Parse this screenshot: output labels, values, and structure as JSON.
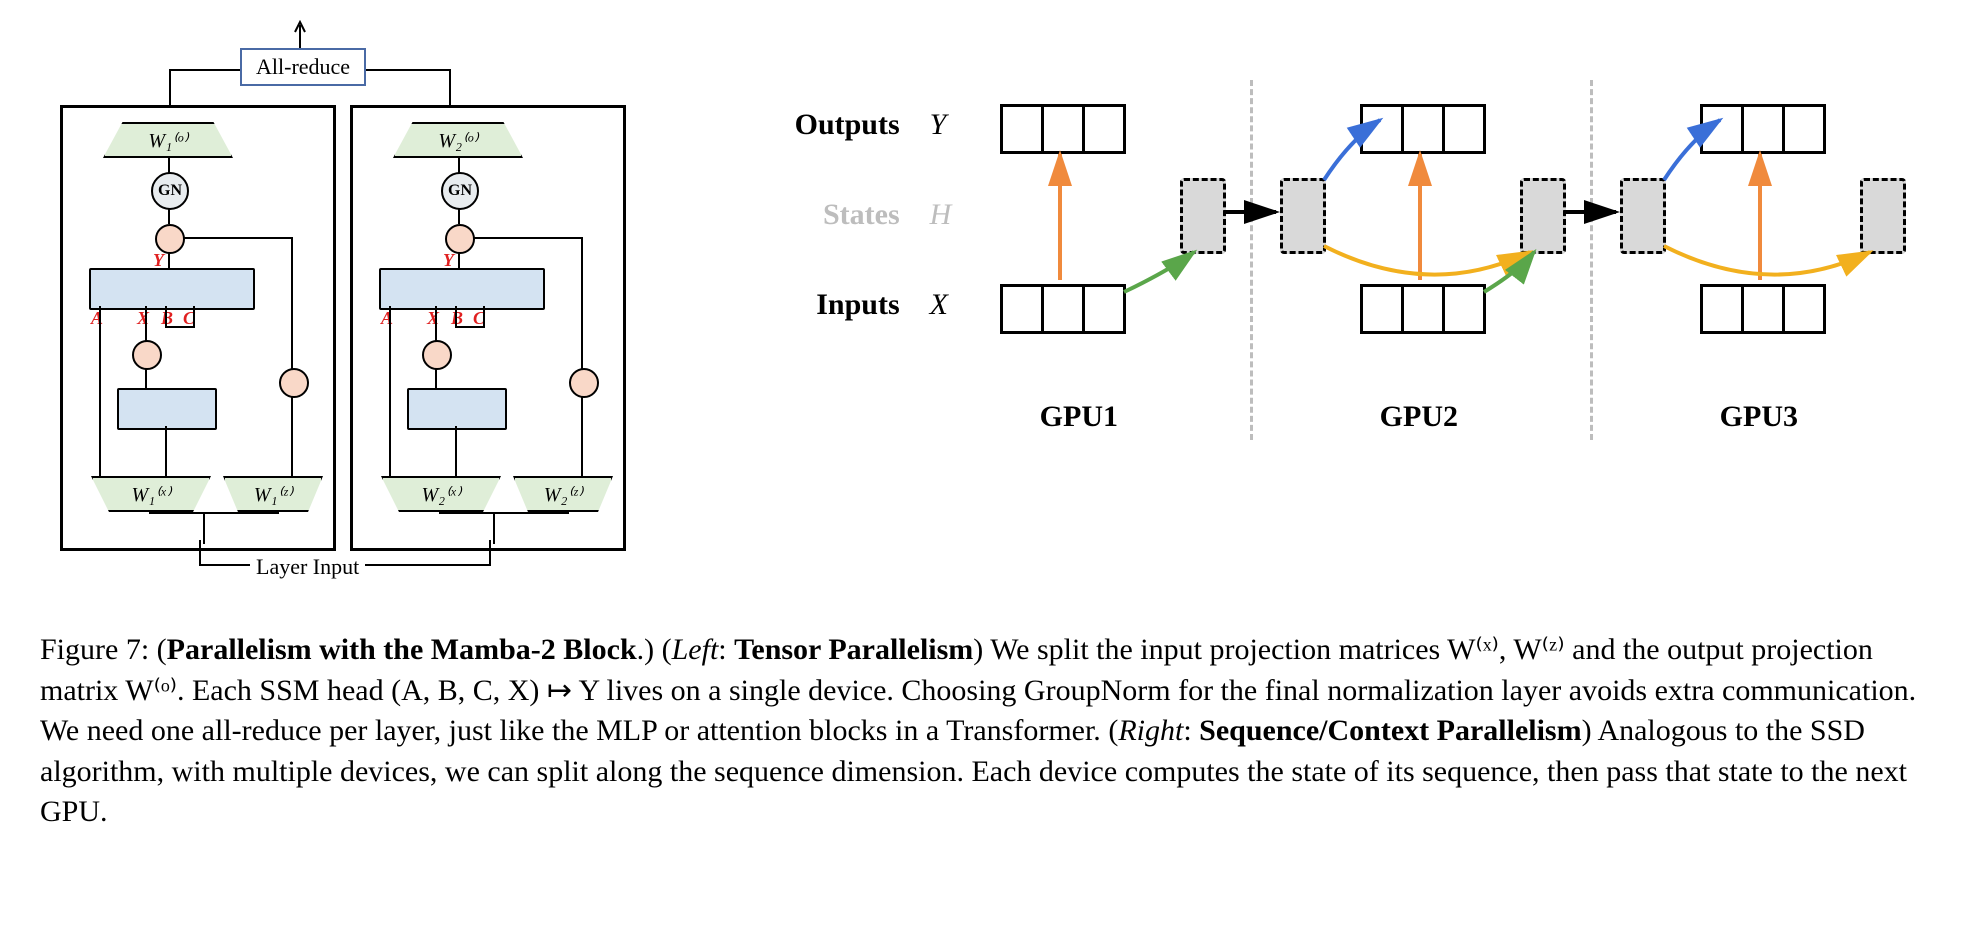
{
  "left": {
    "allreduce": "All-reduce",
    "layer_input": "Layer Input",
    "gn": "GN",
    "red": {
      "A": "A",
      "X": "X",
      "B": "B",
      "C": "C",
      "Y": "Y"
    },
    "w_o_1": "W₁⁽ᵒ⁾",
    "w_o_2": "W₂⁽ᵒ⁾",
    "w_x_1": "W₁⁽ˣ⁾",
    "w_z_1": "W₁⁽ᶻ⁾",
    "w_x_2": "W₂⁽ˣ⁾",
    "w_z_2": "W₂⁽ᶻ⁾"
  },
  "right": {
    "rows": {
      "outputs": "Outputs",
      "states": "States",
      "inputs": "Inputs"
    },
    "syms": {
      "Y": "Y",
      "H": "H",
      "X": "X"
    },
    "gpus": [
      "GPU1",
      "GPU2",
      "GPU3"
    ]
  },
  "caption": {
    "fig": "Figure 7:",
    "title": "Parallelism with the Mamba-2 Block",
    "left_tag": "Left",
    "left_name": "Tensor Parallelism",
    "body_left": "We split the input projection matrices W⁽ˣ⁾, W⁽ᶻ⁾ and the output projection matrix W⁽ᵒ⁾. Each SSM head (A, B, C, X) ↦ Y lives on a single device. Choosing GroupNorm for the final normalization layer avoids extra communication. We need one all-reduce per layer, just like the MLP or attention blocks in a Transformer.",
    "right_tag": "Right",
    "right_name": "Sequence/Context Parallelism",
    "body_right": "Analogous to the SSD algorithm, with multiple devices, we can split along the sequence dimension. Each device computes the state of its sequence, then pass that state to the next GPU."
  }
}
